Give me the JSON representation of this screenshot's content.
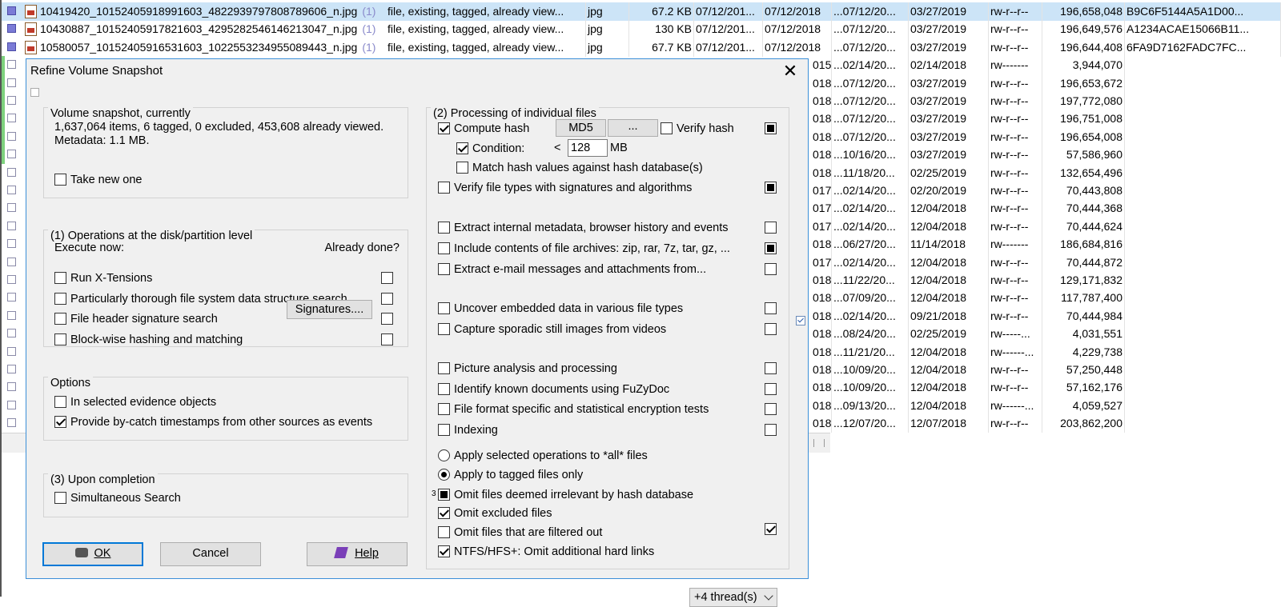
{
  "file_list": {
    "rows": [
      {
        "name": "10419420_10152405918991603_4822939797808789606_n.jpg",
        "count": "(1)",
        "desc": "file, existing, tagged, already view...",
        "type": "jpg",
        "size": "67.2 KB",
        "created": "07/12/201...",
        "modified": "07/12/2018",
        "accessed": "...07/12/20...",
        "changed": "03/27/2019",
        "attr": "rw-r--r--",
        "filesize": "196,658,048",
        "hash": "B9C6F5144A5A1D00...",
        "checked": true,
        "selected": true
      },
      {
        "name": "10430887_10152405917821603_4295282546146213047_n.jpg",
        "count": "(1)",
        "desc": "file, existing, tagged, already view...",
        "type": "jpg",
        "size": "130 KB",
        "created": "07/12/201...",
        "modified": "07/12/2018",
        "accessed": "...07/12/20...",
        "changed": "03/27/2019",
        "attr": "rw-r--r--",
        "filesize": "196,649,576",
        "hash": "A1234ACAE15066B11...",
        "checked": true,
        "selected": false
      },
      {
        "name": "10580057_10152405916531603_1022553234955089443_n.jpg",
        "count": "(1)",
        "desc": "file, existing, tagged, already view...",
        "type": "jpg",
        "size": "67.7 KB",
        "created": "07/12/201...",
        "modified": "07/12/2018",
        "accessed": "...07/12/20...",
        "changed": "03/27/2019",
        "attr": "rw-r--r--",
        "filesize": "196,644,408",
        "hash": "6FA9D7162FADC7FC...",
        "checked": true,
        "selected": false
      },
      {
        "yr": "015",
        "accessed": "...02/14/20...",
        "changed": "02/14/2018",
        "attr": "rw-------",
        "filesize": "3,944,070"
      },
      {
        "yr": "018",
        "accessed": "...07/12/20...",
        "changed": "03/27/2019",
        "attr": "rw-r--r--",
        "filesize": "196,653,672"
      },
      {
        "yr": "018",
        "accessed": "...07/12/20...",
        "changed": "03/27/2019",
        "attr": "rw-r--r--",
        "filesize": "197,772,080"
      },
      {
        "yr": "018",
        "accessed": "...07/12/20...",
        "changed": "03/27/2019",
        "attr": "rw-r--r--",
        "filesize": "196,751,008"
      },
      {
        "yr": "018",
        "accessed": "...07/12/20...",
        "changed": "03/27/2019",
        "attr": "rw-r--r--",
        "filesize": "196,654,008"
      },
      {
        "yr": "018",
        "accessed": "...10/16/20...",
        "changed": "03/27/2019",
        "attr": "rw-r--r--",
        "filesize": "57,586,960"
      },
      {
        "yr": "018",
        "accessed": "...11/18/20...",
        "changed": "02/25/2019",
        "attr": "rw-r--r--",
        "filesize": "132,654,496"
      },
      {
        "yr": "017",
        "accessed": "...02/14/20...",
        "changed": "02/20/2019",
        "attr": "rw-r--r--",
        "filesize": "70,443,808"
      },
      {
        "yr": "017",
        "accessed": "...02/14/20...",
        "changed": "12/04/2018",
        "attr": "rw-r--r--",
        "filesize": "70,444,368"
      },
      {
        "yr": "017",
        "accessed": "...02/14/20...",
        "changed": "12/04/2018",
        "attr": "rw-r--r--",
        "filesize": "70,444,624"
      },
      {
        "yr": "018",
        "accessed": "...06/27/20...",
        "changed": "11/14/2018",
        "attr": "rw-------",
        "filesize": "186,684,816"
      },
      {
        "yr": "017",
        "accessed": "...02/14/20...",
        "changed": "12/04/2018",
        "attr": "rw-r--r--",
        "filesize": "70,444,872"
      },
      {
        "yr": "018",
        "accessed": "...11/22/20...",
        "changed": "12/04/2018",
        "attr": "rw-r--r--",
        "filesize": "129,171,832"
      },
      {
        "yr": "018",
        "accessed": "...07/09/20...",
        "changed": "12/04/2018",
        "attr": "rw-r--r--",
        "filesize": "117,787,400"
      },
      {
        "yr": "018",
        "accessed": "...02/14/20...",
        "changed": "09/21/2018",
        "attr": "rw-r--r--",
        "filesize": "70,444,984"
      },
      {
        "yr": "018",
        "accessed": "...08/24/20...",
        "changed": "02/25/2019",
        "attr": "rw-----...",
        "filesize": "4,031,551"
      },
      {
        "yr": "018",
        "accessed": "...11/21/20...",
        "changed": "12/04/2018",
        "attr": "rw------...",
        "filesize": "4,229,738"
      },
      {
        "yr": "018",
        "accessed": "...10/09/20...",
        "changed": "12/04/2018",
        "attr": "rw-r--r--",
        "filesize": "57,250,448"
      },
      {
        "yr": "018",
        "accessed": "...10/09/20...",
        "changed": "12/04/2018",
        "attr": "rw-r--r--",
        "filesize": "57,162,176"
      },
      {
        "yr": "018",
        "accessed": "...09/13/20...",
        "changed": "12/04/2018",
        "attr": "rw------...",
        "filesize": "4,059,527"
      },
      {
        "yr": "018",
        "accessed": "...12/07/20...",
        "changed": "12/07/2018",
        "attr": "rw-r--r--",
        "filesize": "203,862,200"
      }
    ]
  },
  "dialog": {
    "title": "Refine Volume Snapshot",
    "close_icon": "close-icon",
    "snapshot": {
      "group_title": "Volume snapshot, currently",
      "line1": "1,637,064 items, 6 tagged, 0 excluded, 453,608 already viewed.",
      "line2": "Metadata: 1.1 MB.",
      "take_new": {
        "label": "Take new one",
        "checked": false
      }
    },
    "disk_ops": {
      "group_title": "(1) Operations at the disk/partition level",
      "execute_now": "Execute now:",
      "already_done": "Already done?",
      "items": [
        {
          "label": "Run X-Tensions",
          "checked": false,
          "done": false
        },
        {
          "label": "Particularly thorough file system data structure search",
          "checked": false,
          "done": false
        },
        {
          "label": "File header signature search",
          "checked": false,
          "done": false
        },
        {
          "label": "Block-wise hashing and matching",
          "checked": false,
          "done": false
        }
      ],
      "signatures_button": "Signatures...."
    },
    "options": {
      "group_title": "Options",
      "items": [
        {
          "label": "In selected evidence objects",
          "checked": false
        },
        {
          "label": "Provide by-catch timestamps from other sources as events",
          "checked": true
        }
      ]
    },
    "completion": {
      "group_title": "(3) Upon completion",
      "items": [
        {
          "label": "Simultaneous Search",
          "checked": false
        }
      ]
    },
    "buttons": {
      "ok": "OK",
      "cancel": "Cancel",
      "help": "Help"
    },
    "processing": {
      "group_title": "(2) Processing of individual files",
      "compute_hash": {
        "label": "Compute hash",
        "checked": true
      },
      "hash_type": "MD5",
      "hash_more": "...",
      "verify_hash": {
        "label": "Verify hash",
        "checked": false
      },
      "condition": {
        "label": "Condition:",
        "checked": true,
        "operator": "<",
        "value": "128",
        "unit": "MB"
      },
      "match_hash": {
        "label": "Match hash values against hash database(s)",
        "checked": false
      },
      "verify_types": {
        "label": "Verify file types with signatures and algorithms",
        "checked": false
      },
      "extract_metadata": {
        "label": "Extract internal metadata, browser history and events",
        "checked": false
      },
      "include_archives": {
        "label": "Include contents of file archives: zip, rar, 7z, tar, gz, ...",
        "checked": false
      },
      "extract_email": {
        "label": "Extract e-mail messages and attachments from...",
        "checked": false
      },
      "uncover_embedded": {
        "label": "Uncover embedded data in various file types",
        "checked": false
      },
      "capture_stills": {
        "label": "Capture sporadic still images from videos",
        "checked": false
      },
      "picture_analysis": {
        "label": "Picture analysis and processing",
        "checked": false
      },
      "fuzzydoc": {
        "label": "Identify known documents using FuZyDoc",
        "checked": false
      },
      "encryption_tests": {
        "label": "File format specific and statistical encryption tests",
        "checked": false
      },
      "indexing": {
        "label": "Indexing",
        "checked": false
      },
      "apply_all": {
        "label": "Apply selected operations to *all* files",
        "selected": false
      },
      "apply_tagged": {
        "label": "Apply to tagged files only",
        "selected": true
      },
      "omit_irrelevant": {
        "label": "Omit files deemed irrelevant by hash database",
        "state": "indeterminate",
        "marker": "3"
      },
      "omit_excluded": {
        "label": "Omit excluded files",
        "checked": true
      },
      "omit_filtered": {
        "label": "Omit files that are filtered out",
        "checked": false
      },
      "omit_hardlinks": {
        "label": "NTFS/HFS+: Omit additional hard links",
        "checked": true
      },
      "threads": "+4 thread(s)"
    }
  }
}
